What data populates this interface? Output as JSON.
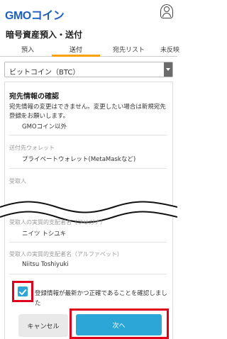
{
  "header": {
    "logo_text": "GMOコイン",
    "logo_color": "#1f5fbd"
  },
  "page": {
    "title": "暗号資産預入・送付"
  },
  "tabs": [
    {
      "label": "預入",
      "active": false
    },
    {
      "label": "送付",
      "active": true
    },
    {
      "label": "宛先リスト",
      "active": false
    },
    {
      "label": "未反映",
      "active": false
    }
  ],
  "asset_select": {
    "value": "ビットコイン（BTC）"
  },
  "confirmation": {
    "title": "宛先情報の確認",
    "notice": "宛先情報の変更はできません。変更したい場合は新規宛先登録をお願いします。",
    "fields": [
      {
        "label": "送付先",
        "value": "GMOコイン以外"
      },
      {
        "label": "送付先ウォレット",
        "value": "プライベートウォレット(MetaMaskなど)"
      },
      {
        "label": "受取人",
        "value": ""
      },
      {
        "label": "受取人の実質的支配者名（フリガナ）",
        "value": "ニイツ トシユキ"
      },
      {
        "label": "受取人の実質的支配者名（アルファベット）",
        "value": "Niitsu Toshiyuki"
      }
    ]
  },
  "agreement": {
    "checked": true,
    "label": "登録情報が最新かつ正確であることを確認しました"
  },
  "buttons": {
    "cancel_label": "キャンセル",
    "next_label": "次へ"
  },
  "colors": {
    "accent_tab": "#ffa200",
    "primary_button": "#2ba6d6",
    "highlight": "#e0001b"
  }
}
